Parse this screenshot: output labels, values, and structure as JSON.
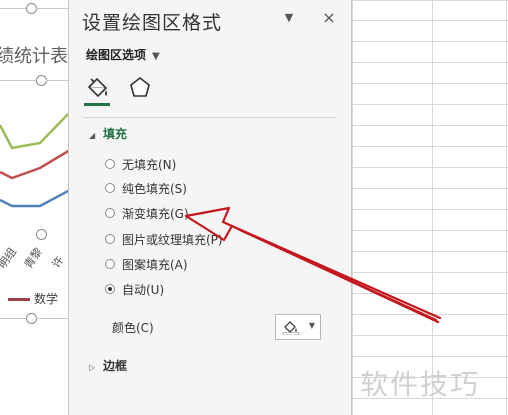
{
  "chart": {
    "title_fragment": "绩统计表",
    "axis_labels": [
      "明组",
      "青黎",
      "许"
    ],
    "legend_label": "数学",
    "series_colors": [
      "#9bbb59",
      "#c0504d",
      "#4f81bd"
    ]
  },
  "pane": {
    "title": "设置绘图区格式",
    "menu_icon": "triangle-down",
    "close_icon": "×",
    "options_dropdown": "绘图区选项",
    "tabs": [
      "fill-and-line",
      "effects"
    ],
    "fill_section": {
      "label": "填充",
      "options": [
        {
          "label": "无填充(N)",
          "checked": false
        },
        {
          "label": "纯色填充(S)",
          "checked": false
        },
        {
          "label": "渐变填充(G)",
          "checked": false
        },
        {
          "label": "图片或纹理填充(P)",
          "checked": false
        },
        {
          "label": "图案填充(A)",
          "checked": false
        },
        {
          "label": "自动(U)",
          "checked": true
        }
      ],
      "color_label": "颜色(C)"
    },
    "border_section": {
      "label": "边框"
    }
  },
  "annotation_color": "#c4161c",
  "watermark": "软件技巧"
}
